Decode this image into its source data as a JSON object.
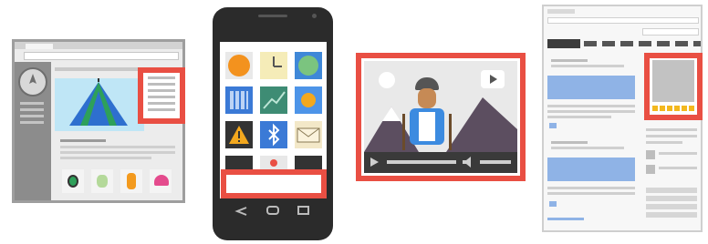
{
  "illustrations": [
    {
      "name": "desktop-website-display-ad",
      "highlight": "skyscraper-ad"
    },
    {
      "name": "mobile-app-banner-ad",
      "highlight": "banner-ad"
    },
    {
      "name": "video-player-ad",
      "highlight": "video-player"
    },
    {
      "name": "webpage-rectangle-ad",
      "highlight": "rectangle-ad"
    }
  ],
  "colors": {
    "highlight": "#e94f43",
    "browser_frame": "#9a9a9a",
    "phone_body": "#2b2b2b",
    "sky_blue": "#bfe6f6",
    "link_blue": "#8fb3e6"
  },
  "icons": [
    "compass-icon",
    "clock-icon",
    "globe-icon",
    "calculator-icon",
    "chart-icon",
    "sun-icon",
    "warning-icon",
    "bluetooth-icon",
    "mail-icon",
    "play-icon",
    "volume-icon",
    "back-icon",
    "home-icon",
    "recent-apps-icon"
  ]
}
